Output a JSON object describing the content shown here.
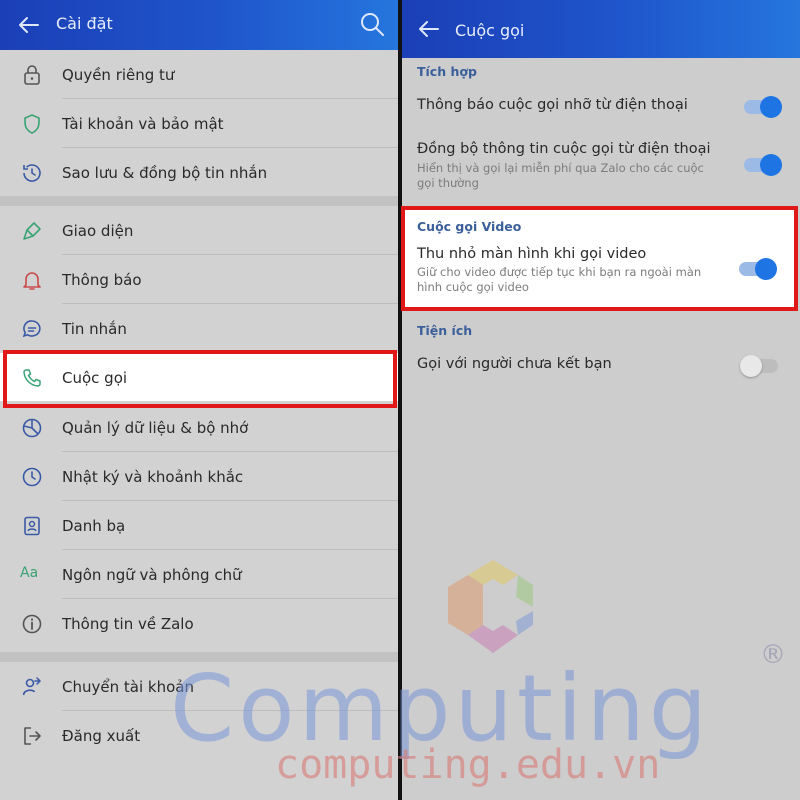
{
  "left": {
    "title": "Cài đặt",
    "items": [
      {
        "label": "Quyền riêng tư",
        "icon": "lock-icon"
      },
      {
        "label": "Tài khoản và bảo mật",
        "icon": "shield-icon"
      },
      {
        "label": "Sao lưu & đồng bộ tin nhắn",
        "icon": "history-icon"
      },
      {
        "label": "Giao diện",
        "icon": "paint-brush-icon"
      },
      {
        "label": "Thông báo",
        "icon": "bell-icon"
      },
      {
        "label": "Tin nhắn",
        "icon": "chat-bubble-icon"
      },
      {
        "label": "Cuộc gọi",
        "icon": "phone-icon",
        "selected": true
      },
      {
        "label": "Quản lý dữ liệu & bộ nhớ",
        "icon": "pie-chart-icon"
      },
      {
        "label": "Nhật ký và khoảnh khắc",
        "icon": "clock-icon"
      },
      {
        "label": "Danh bạ",
        "icon": "contacts-icon"
      },
      {
        "label": "Ngôn ngữ và phông chữ",
        "icon": "font-icon",
        "icon_text": "Aa"
      },
      {
        "label": "Thông tin về Zalo",
        "icon": "info-icon"
      },
      {
        "label": "Chuyển tài khoản",
        "icon": "switch-account-icon"
      },
      {
        "label": "Đăng xuất",
        "icon": "logout-icon"
      }
    ]
  },
  "right": {
    "title": "Cuộc gọi",
    "sections": [
      {
        "title": "Tích hợp"
      },
      {
        "title": "Cuộc gọi Video"
      },
      {
        "title": "Tiện ích"
      }
    ],
    "settings": [
      {
        "title": "Thông báo cuộc gọi nhỡ từ điện thoại",
        "subtitle": "",
        "on": true
      },
      {
        "title": "Đồng bộ thông tin cuộc gọi từ điện thoại",
        "subtitle": "Hiển thị và gọi lại miễn phí qua Zalo cho các cuộc gọi thường",
        "on": true
      },
      {
        "title": "Thu nhỏ màn hình khi gọi video",
        "subtitle": "Giữ cho video được tiếp tục khi bạn ra ngoài màn hình cuộc gọi video",
        "on": true
      },
      {
        "title": "Gọi với người chưa kết bạn",
        "subtitle": "",
        "on": false
      }
    ]
  },
  "watermark": {
    "brand": "Computing",
    "url": "computing.edu.vn",
    "reg": "®"
  },
  "colors": {
    "appbar": "#1f55cc",
    "highlight": "#e01818",
    "switch_on": "#1f74e3",
    "section_title": "#3a5f9a"
  }
}
